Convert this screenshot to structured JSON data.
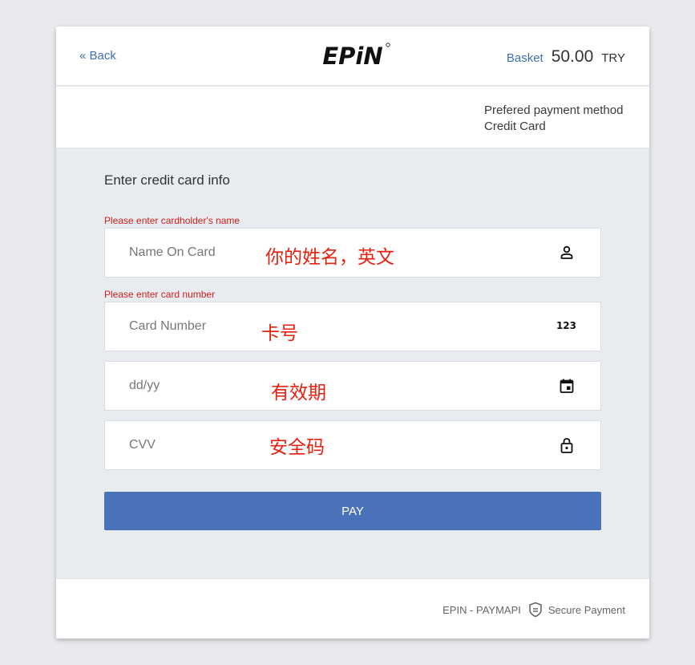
{
  "header": {
    "back_label": "« Back",
    "logo_text": "EPiN",
    "basket_label": "Basket",
    "basket_amount": "50.00",
    "basket_currency": "TRY"
  },
  "payment_method": {
    "title": "Prefered payment method",
    "value": "Credit Card"
  },
  "form": {
    "title": "Enter credit card info",
    "name_error": "Please enter cardholder's name",
    "name_placeholder": "Name On Card",
    "name_annotation": "你的姓名，英文",
    "number_error": "Please enter card number",
    "number_placeholder": "Card Number",
    "number_annotation": "卡号",
    "number_icon_text": "123",
    "expiry_placeholder": "dd/yy",
    "expiry_annotation": "有效期",
    "cvv_placeholder": "CVV",
    "cvv_annotation": "安全码",
    "pay_label": "PAY"
  },
  "footer": {
    "provider": "EPIN - PAYMAPI",
    "secure_label": "Secure Payment"
  },
  "icons": {
    "name": "person-icon",
    "number": "numbers-icon",
    "expiry": "calendar-icon",
    "cvv": "lock-icon",
    "secure": "shield-icon"
  },
  "colors": {
    "accent": "#4a72ba",
    "link": "#3f6fb5",
    "error": "#d0211c",
    "annotation": "#e8200e"
  }
}
